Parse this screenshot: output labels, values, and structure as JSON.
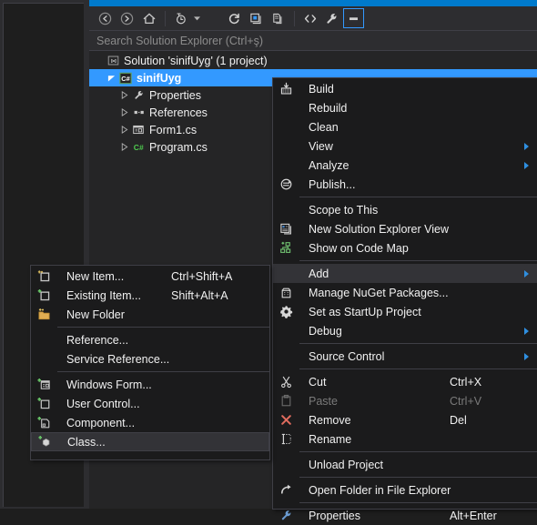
{
  "window": {
    "accent_color": "#007acc",
    "panel_bg": "#252526",
    "menu_bg": "#1b1b1c"
  },
  "toolbar": {
    "buttons": [
      {
        "name": "back-icon",
        "label": "Back"
      },
      {
        "name": "forward-icon",
        "label": "Forward"
      },
      {
        "name": "home-icon",
        "label": "Home"
      },
      {
        "name": "pending-changes-icon",
        "label": "Pending Changes Filter"
      },
      {
        "name": "sync-with-active-document-icon",
        "label": "Sync with Active Document"
      },
      {
        "name": "refresh-icon",
        "label": "Refresh"
      },
      {
        "name": "collapse-all-icon",
        "label": "Collapse All"
      },
      {
        "name": "show-all-files-icon",
        "label": "Show All Files"
      },
      {
        "name": "view-code-icon",
        "label": "View Code"
      },
      {
        "name": "properties-icon",
        "label": "Properties"
      },
      {
        "name": "preview-selected-items-icon",
        "label": "Preview Selected Items"
      }
    ]
  },
  "search": {
    "placeholder": "Search Solution Explorer (Ctrl+ş)"
  },
  "tree": {
    "items": [
      {
        "label": "Solution 'sinifUyg' (1 project)",
        "icon": "solution-icon",
        "indent": 0,
        "twisty": "none",
        "selected": false,
        "bold": false
      },
      {
        "label": "sinifUyg",
        "icon": "csharp-project-icon",
        "indent": 1,
        "twisty": "expanded",
        "selected": true,
        "bold": true
      },
      {
        "label": "Properties",
        "icon": "wrench-icon",
        "indent": 2,
        "twisty": "collapsed",
        "selected": false,
        "bold": false
      },
      {
        "label": "References",
        "icon": "references-icon",
        "indent": 2,
        "twisty": "collapsed",
        "selected": false,
        "bold": false
      },
      {
        "label": "Form1.cs",
        "icon": "windows-form-icon",
        "indent": 2,
        "twisty": "collapsed",
        "selected": false,
        "bold": false
      },
      {
        "label": "Program.cs",
        "icon": "csharp-file-icon",
        "indent": 2,
        "twisty": "collapsed",
        "selected": false,
        "bold": false
      }
    ]
  },
  "context_menu": {
    "items": [
      {
        "label": "Build",
        "icon": "build-icon",
        "key": "",
        "arrow": false,
        "highlighted": false,
        "disabled": false,
        "sep_after": false
      },
      {
        "label": "Rebuild",
        "icon": "",
        "key": "",
        "arrow": false,
        "highlighted": false,
        "disabled": false,
        "sep_after": false
      },
      {
        "label": "Clean",
        "icon": "",
        "key": "",
        "arrow": false,
        "highlighted": false,
        "disabled": false,
        "sep_after": false
      },
      {
        "label": "View",
        "icon": "",
        "key": "",
        "arrow": true,
        "highlighted": false,
        "disabled": false,
        "sep_after": false
      },
      {
        "label": "Analyze",
        "icon": "",
        "key": "",
        "arrow": true,
        "highlighted": false,
        "disabled": false,
        "sep_after": false
      },
      {
        "label": "Publish...",
        "icon": "publish-icon",
        "key": "",
        "arrow": false,
        "highlighted": false,
        "disabled": false,
        "sep_after": true
      },
      {
        "label": "Scope to This",
        "icon": "",
        "key": "",
        "arrow": false,
        "highlighted": false,
        "disabled": false,
        "sep_after": false
      },
      {
        "label": "New Solution Explorer View",
        "icon": "new-view-icon",
        "key": "",
        "arrow": false,
        "highlighted": false,
        "disabled": false,
        "sep_after": false
      },
      {
        "label": "Show on Code Map",
        "icon": "code-map-icon",
        "key": "",
        "arrow": false,
        "highlighted": false,
        "disabled": false,
        "sep_after": true
      },
      {
        "label": "Add",
        "icon": "",
        "key": "",
        "arrow": true,
        "highlighted": true,
        "disabled": false,
        "sep_after": false
      },
      {
        "label": "Manage NuGet Packages...",
        "icon": "nuget-icon",
        "key": "",
        "arrow": false,
        "highlighted": false,
        "disabled": false,
        "sep_after": false
      },
      {
        "label": "Set as StartUp Project",
        "icon": "gear-icon",
        "key": "",
        "arrow": false,
        "highlighted": false,
        "disabled": false,
        "sep_after": false
      },
      {
        "label": "Debug",
        "icon": "",
        "key": "",
        "arrow": true,
        "highlighted": false,
        "disabled": false,
        "sep_after": true
      },
      {
        "label": "Source Control",
        "icon": "",
        "key": "",
        "arrow": true,
        "highlighted": false,
        "disabled": false,
        "sep_after": true
      },
      {
        "label": "Cut",
        "icon": "cut-icon",
        "key": "Ctrl+X",
        "arrow": false,
        "highlighted": false,
        "disabled": false,
        "sep_after": false
      },
      {
        "label": "Paste",
        "icon": "paste-icon",
        "key": "Ctrl+V",
        "arrow": false,
        "highlighted": false,
        "disabled": true,
        "sep_after": false
      },
      {
        "label": "Remove",
        "icon": "remove-icon",
        "key": "Del",
        "arrow": false,
        "highlighted": false,
        "disabled": false,
        "sep_after": false
      },
      {
        "label": "Rename",
        "icon": "rename-icon",
        "key": "",
        "arrow": false,
        "highlighted": false,
        "disabled": false,
        "sep_after": true
      },
      {
        "label": "Unload Project",
        "icon": "",
        "key": "",
        "arrow": false,
        "highlighted": false,
        "disabled": false,
        "sep_after": true
      },
      {
        "label": "Open Folder in File Explorer",
        "icon": "open-folder-icon",
        "key": "",
        "arrow": false,
        "highlighted": false,
        "disabled": false,
        "sep_after": true
      },
      {
        "label": "Properties",
        "icon": "properties-wrench-icon",
        "key": "Alt+Enter",
        "arrow": false,
        "highlighted": false,
        "disabled": false,
        "sep_after": false
      }
    ]
  },
  "add_submenu": {
    "items": [
      {
        "label": "New Item...",
        "icon": "new-item-icon",
        "key": "Ctrl+Shift+A",
        "highlighted": false,
        "sep_after": false
      },
      {
        "label": "Existing Item...",
        "icon": "existing-item-icon",
        "key": "Shift+Alt+A",
        "highlighted": false,
        "sep_after": false
      },
      {
        "label": "New Folder",
        "icon": "new-folder-icon",
        "key": "",
        "highlighted": false,
        "sep_after": true
      },
      {
        "label": "Reference...",
        "icon": "",
        "key": "",
        "highlighted": false,
        "sep_after": false
      },
      {
        "label": "Service Reference...",
        "icon": "",
        "key": "",
        "highlighted": false,
        "sep_after": true
      },
      {
        "label": "Windows Form...",
        "icon": "windows-form-add-icon",
        "key": "",
        "highlighted": false,
        "sep_after": false
      },
      {
        "label": "User Control...",
        "icon": "user-control-icon",
        "key": "",
        "highlighted": false,
        "sep_after": false
      },
      {
        "label": "Component...",
        "icon": "component-icon",
        "key": "",
        "highlighted": false,
        "sep_after": false
      },
      {
        "label": "Class...",
        "icon": "class-icon",
        "key": "",
        "highlighted": true,
        "sep_after": false
      }
    ]
  }
}
